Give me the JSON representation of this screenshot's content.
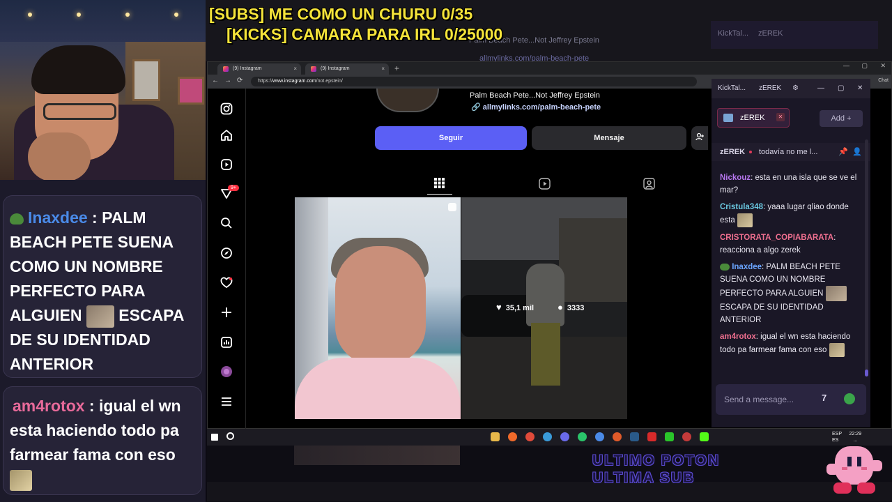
{
  "overlay": {
    "subs_line": "[SUBS] ME COMO UN CHURU 0/35",
    "kicks_line": "[KICKS] CAMARA PARA IRL 0/25000",
    "bottom_line1": "ULTIMO POTON",
    "bottom_line2": "ULTIMA SUB"
  },
  "left_chat": {
    "msg1": {
      "user": "Inaxdee",
      "sep": " : ",
      "text_a": "PALM BEACH PETE SUENA COMO UN NOMBRE PERFECTO PARA ALGUIEN",
      "text_b": "ESCAPA DE SU IDENTIDAD ANTERIOR"
    },
    "msg2": {
      "user": "am4rotox",
      "sep": " : ",
      "text": "igual el wn esta haciendo todo pa farmear fama con eso"
    },
    "colors": {
      "inaxdee": "#4a8ae8",
      "am4rotox": "#e86a9a"
    }
  },
  "browser": {
    "tab1": "(9) Instagram",
    "tab2": "(9) Instagram",
    "tab_close": "×",
    "new_tab": "+",
    "url_prefix": "https://",
    "url_host": "www.instagram.com",
    "url_path": "/not.epstein/",
    "back": "←",
    "forward": "→",
    "reload": "⟳",
    "win_min": "—",
    "win_max": "▢",
    "win_close": "✕",
    "chat_label": "Chat"
  },
  "instagram": {
    "notif_count": "9+",
    "bio_name": "Palm Beach Pete...Not Jeffrey Epstein",
    "bio_link": "allmylinks.com/palm-beach-pete",
    "follow": "Seguir",
    "message": "Mensaje",
    "post_likes": "35,1 mil",
    "post_comments": "3333"
  },
  "ghost": {
    "url1": "Palm Beach Pete...Not Jeffrey Epstein",
    "url2": "allmylinks.com/palm-beach-pete",
    "kick_label": "KickTal...",
    "channel": "zEREK"
  },
  "kick": {
    "title": "KickTal...",
    "channel_short": "zEREK",
    "channel_tab": "zEREK",
    "add": "Add",
    "pinned_user": "zEREK",
    "pinned_text": "todavía no me l...",
    "messages": [
      {
        "user": "Nickouz",
        "color": "#b878f0",
        "text": "esta en una isla que se ve el mar?"
      },
      {
        "user": "Cristula348",
        "color": "#6ac8e0",
        "text": "yaaa lugar qliao donde esta"
      },
      {
        "user": "CRISTORATA_COPIABARATA",
        "color": "#f07090",
        "text": "reacciona a algo zerek"
      },
      {
        "user": "Inaxdee",
        "color": "#6aa4ff",
        "text_a": "PALM BEACH PETE SUENA COMO UN NOMBRE PERFECTO PARA ALGUIEN",
        "text_b": "ESCAPA DE SU IDENTIDAD ANTERIOR"
      },
      {
        "user": "am4rotox",
        "color": "#f07090",
        "text": "igual el wn esta haciendo todo pa farmear fama con eso"
      }
    ],
    "placeholder": "Send a message..."
  },
  "taskbar": {
    "lang": "ESP",
    "lang2": "ES",
    "time": "22:29",
    "date": "..."
  }
}
